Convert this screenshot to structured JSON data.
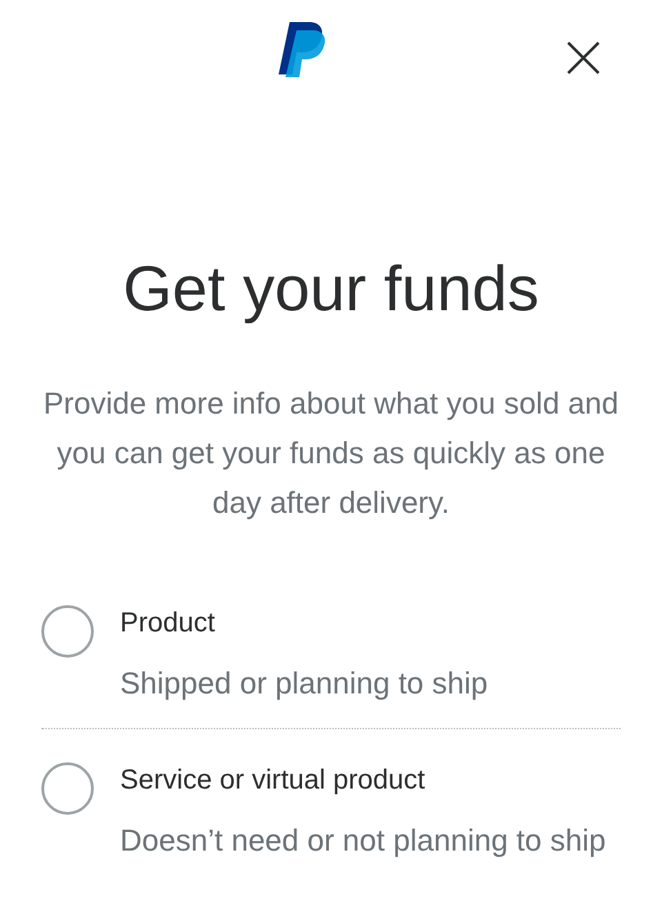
{
  "title": "Get your funds",
  "description": "Provide more info about what you sold and you can get your funds as quickly as one day after delivery.",
  "options": [
    {
      "label": "Product",
      "description": "Shipped or planning to ship",
      "selected": false
    },
    {
      "label": "Service or virtual product",
      "description": "Doesn’t need or not planning to ship",
      "selected": false
    }
  ]
}
